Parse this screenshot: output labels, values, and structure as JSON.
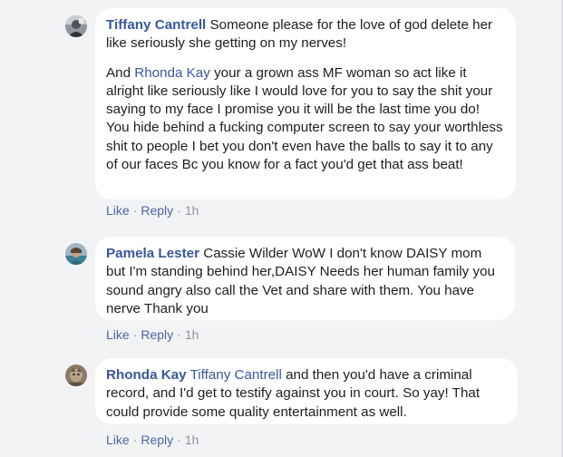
{
  "comments": [
    {
      "author": "Tiffany Cantrell",
      "avatar_icon": "profile-photo-icon",
      "paragraph1": "Someone please for the love of god delete her like seriously she getting on my nerves!",
      "paragraph2_prefix": "And ",
      "paragraph2_mention": "Rhonda Kay",
      "paragraph2_text": " your a grown ass MF woman so act like it alright like seriously like I would love for you to say the shit your saying to my face I promise you it will be the last time you do! You hide behind a fucking computer screen to say your worthless shit to people I bet you don't even have the balls to say it to any of our faces Bc you know for a fact you'd get that ass beat!",
      "like_label": "Like",
      "separator": "·",
      "reply_label": "Reply",
      "time": "1h"
    },
    {
      "author": "Pamela Lester",
      "avatar_icon": "profile-photo-icon",
      "text": "Cassie Wilder WoW I don't know DAISY mom but I'm standing behind her,DAISY Needs her human family you sound angry also call the Vet and share with them. You have nerve Thank you",
      "like_label": "Like",
      "separator": "·",
      "reply_label": "Reply",
      "time": "1h"
    },
    {
      "author": "Rhonda Kay",
      "avatar_icon": "profile-photo-icon",
      "mention": "Tiffany Cantrell",
      "text": " and then you'd have a criminal record, and I'd get to testify against you in court. So yay! That could provide some quality entertainment as well.",
      "like_label": "Like",
      "separator": "·",
      "reply_label": "Reply",
      "time": "1h"
    }
  ]
}
